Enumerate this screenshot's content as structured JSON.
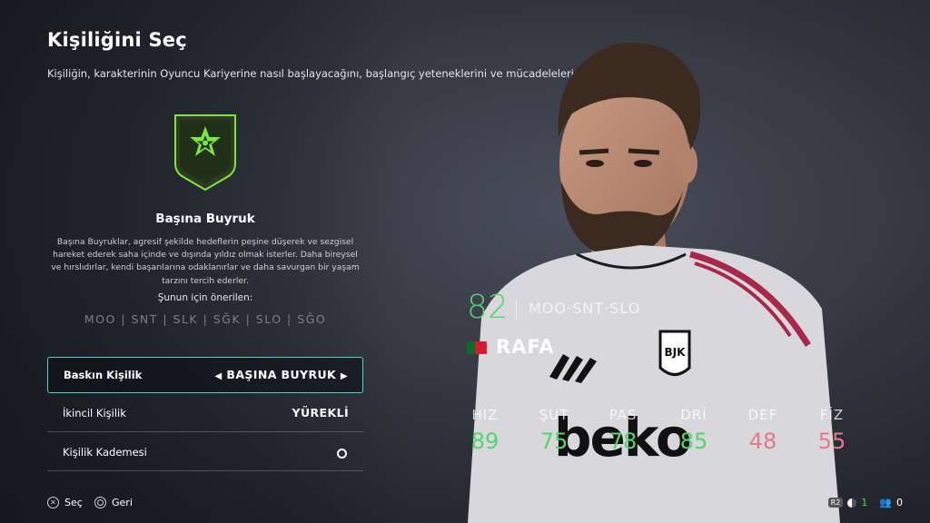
{
  "header": {
    "title": "Kişiliğini Seç",
    "subtitle": "Kişiliğin, karakterinin Oyuncu Kariyerine nasıl başlayacağını, başlangıç yeteneklerini ve mücadelelerini etkiler."
  },
  "persona": {
    "icon": "star-shield-icon",
    "name": "Başına Buyruk",
    "description": "Başına Buyruklar, agresif şekilde hedeflerin peşine düşerek ve sezgisel hareket ederek saha içinde ve dışında yıldız olmak isterler. Daha bireysel ve hırslıdırlar, kendi başarılarına odaklanırlar ve daha savurgan bir yaşam tarzını tercih ederler.",
    "recommended_title": "Şunun için önerilen:",
    "recommended_positions": "MOO | SNT | SLK | SĞK | SLO | SĞO"
  },
  "options": [
    {
      "label": "Baskın Kişilik",
      "value": "BAŞINA BUYRUK",
      "selected": true,
      "left_arrow": "◀",
      "right_arrow": "▶"
    },
    {
      "label": "İkincil Kişilik",
      "value": "YÜREKLİ"
    },
    {
      "label": "Kişilik Kademesi",
      "value_icon": "circle-icon"
    }
  ],
  "player": {
    "overall": "82",
    "positions": "MOO·SNT·SLO",
    "name": "RAFA",
    "nation_flag": "portugal-flag-icon",
    "stats": [
      {
        "label": "HIZ",
        "value": "89",
        "color": "#52d66a"
      },
      {
        "label": "ŞUT",
        "value": "75",
        "color": "#52d66a"
      },
      {
        "label": "PAS",
        "value": "78",
        "color": "#52d66a"
      },
      {
        "label": "DRİ",
        "value": "85",
        "color": "#52d66a"
      },
      {
        "label": "DEF",
        "value": "48",
        "color": "#e57a86"
      },
      {
        "label": "FİZ",
        "value": "55",
        "color": "#e57a86"
      }
    ],
    "shirt_sponsor": "beko"
  },
  "footer": {
    "select_label": "Seç",
    "back_label": "Geri",
    "hud_r2": "R2",
    "hud_count_1": "1",
    "hud_count_2": "0"
  },
  "colors": {
    "accent": "#4fd3c8",
    "positive": "#52d66a",
    "negative": "#e57a86",
    "badge_green": "#7ee83a"
  }
}
